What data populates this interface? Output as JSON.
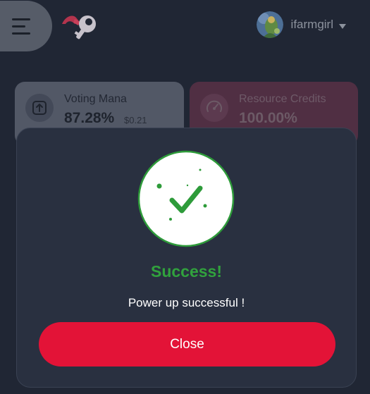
{
  "header": {
    "menu_icon": "hamburger-menu-icon",
    "logo_icon": "key-logo-icon",
    "username": "ifarmgirl",
    "avatar_icon": "user-avatar"
  },
  "cards": {
    "voting": {
      "label": "Voting Mana",
      "value": "87.28%",
      "sub_value": "$0.21",
      "icon": "upload-icon"
    },
    "resource": {
      "label": "Resource Credits",
      "value": "100.00%",
      "icon": "gauge-icon"
    }
  },
  "modal": {
    "title": "Success!",
    "message": "Power up successful !",
    "close_label": "Close",
    "icon": "success-check-icon"
  },
  "colors": {
    "background": "#202634",
    "modal_background": "#293040",
    "success_green": "#31a23d",
    "accent_red": "#e31337"
  }
}
